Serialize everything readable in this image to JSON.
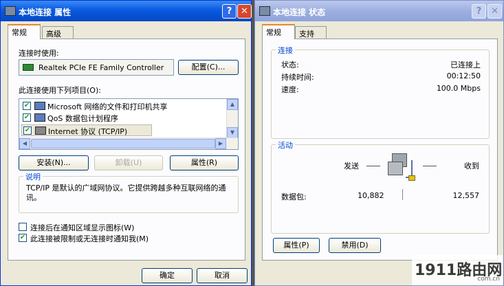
{
  "props": {
    "title": "本地连接 属性",
    "tabs": [
      "常规",
      "高级"
    ],
    "connect_using": "连接时使用:",
    "adapter": "Realtek PCIe FE Family Controller",
    "configure": "配置(C)...",
    "items_label": "此连接使用下列项目(O):",
    "items": [
      "Microsoft 网络的文件和打印机共享",
      "QoS 数据包计划程序",
      "Internet 协议 (TCP/IP)"
    ],
    "install": "安装(N)...",
    "uninstall": "卸载(U)",
    "properties": "属性(R)",
    "desc_title": "说明",
    "desc": "TCP/IP 是默认的广域网协议。它提供跨越多种互联网络的通讯。",
    "show_icon": "连接后在通知区域显示图标(W)",
    "notify": "此连接被限制或无连接时通知我(M)",
    "ok": "确定",
    "cancel": "取消"
  },
  "status": {
    "title": "本地连接 状态",
    "tabs": [
      "常规",
      "支持"
    ],
    "conn_group": "连接",
    "status_label": "状态:",
    "status_value": "已连接上",
    "duration_label": "持续时间:",
    "duration_value": "00:12:50",
    "speed_label": "速度:",
    "speed_value": "100.0 Mbps",
    "activity_group": "活动",
    "sent": "发送",
    "received": "收到",
    "packets_label": "数据包:",
    "sent_value": "10,882",
    "recv_value": "12,557",
    "properties": "属性(P)",
    "disable": "禁用(D)"
  },
  "watermark": {
    "domain": "1911路由网",
    "sub": "com.cn"
  }
}
